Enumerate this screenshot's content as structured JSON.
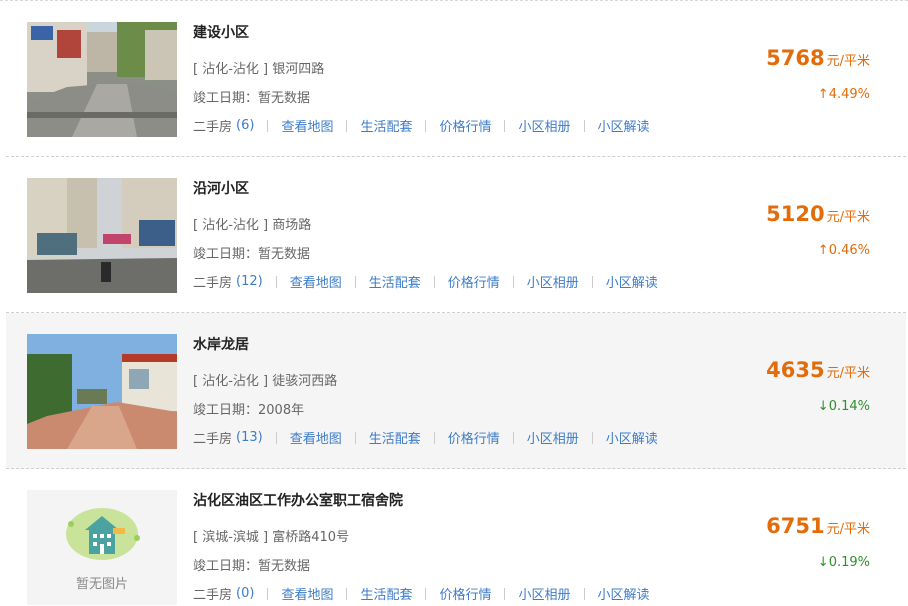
{
  "list": [
    {
      "name": "建设小区",
      "area": "[ 沾化-沾化 ]",
      "road": "银河四路",
      "completion": "竣工日期：暂无数据",
      "second_hand_label": "二手房",
      "second_hand_count": "(6)",
      "price": "5768",
      "price_unit": "元/平米",
      "change": "↑4.49%",
      "trend": "up",
      "image": "street-photo"
    },
    {
      "name": "沿河小区",
      "area": "[ 沾化-沾化 ]",
      "road": "商场路",
      "completion": "竣工日期：暂无数据",
      "second_hand_label": "二手房",
      "second_hand_count": "(12)",
      "price": "5120",
      "price_unit": "元/平米",
      "change": "↑0.46%",
      "trend": "up",
      "image": "street-photo"
    },
    {
      "name": "水岸龙居",
      "area": "[ 沾化-沾化 ]",
      "road": "徒骇河西路",
      "completion": "竣工日期：2008年",
      "second_hand_label": "二手房",
      "second_hand_count": "(13)",
      "price": "4635",
      "price_unit": "元/平米",
      "change": "↓0.14%",
      "trend": "down",
      "image": "gate-photo"
    },
    {
      "name": "沾化区油区工作办公室职工宿舍院",
      "area": "[ 滨城-滨城 ]",
      "road": "富桥路410号",
      "completion": "竣工日期：暂无数据",
      "second_hand_label": "二手房",
      "second_hand_count": "(0)",
      "price": "6751",
      "price_unit": "元/平米",
      "change": "↓0.19%",
      "trend": "down",
      "image": "no-image",
      "no_image_text": "暂无图片"
    }
  ],
  "links": {
    "map": "查看地图",
    "life": "生活配套",
    "price": "价格行情",
    "album": "小区相册",
    "analysis": "小区解读"
  },
  "colors": {
    "price": "#e36c0a",
    "up": "#e36c0a",
    "down": "#2f8f2f",
    "link": "#3d7cc9"
  }
}
